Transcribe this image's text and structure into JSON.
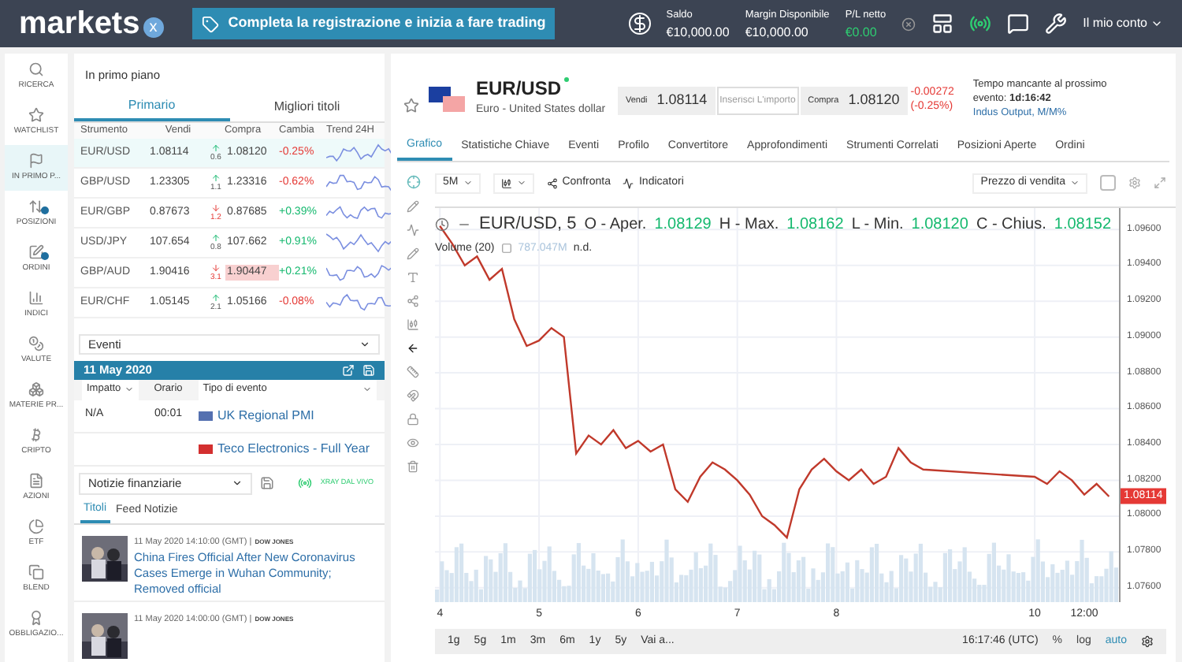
{
  "topbar": {
    "logo": "markets",
    "logo_mark": "x",
    "banner": "Completa la registrazione e inizia a fare trading",
    "stats": [
      {
        "label": "Saldo",
        "value": "€10,000.00",
        "positive": false
      },
      {
        "label": "Margin Disponibile",
        "value": "€10,000.00",
        "positive": false
      },
      {
        "label": "P/L netto",
        "value": "€0.00",
        "positive": true
      }
    ],
    "account": "Il mio conto"
  },
  "sidebar": {
    "items": [
      {
        "label": "RICERCA",
        "selected": false,
        "badge": false
      },
      {
        "label": "WATCHLIST",
        "selected": false,
        "badge": false
      },
      {
        "label": "IN PRIMO P...",
        "selected": true,
        "badge": false
      },
      {
        "label": "POSIZIONI",
        "selected": false,
        "badge": true
      },
      {
        "label": "ORDINI",
        "selected": false,
        "badge": true
      },
      {
        "label": "INDICI",
        "selected": false,
        "badge": false
      },
      {
        "label": "VALUTE",
        "selected": false,
        "badge": false
      },
      {
        "label": "MATERIE PR...",
        "selected": false,
        "badge": false
      },
      {
        "label": "CRIPTO",
        "selected": false,
        "badge": false
      },
      {
        "label": "AZIONI",
        "selected": false,
        "badge": false
      },
      {
        "label": "ETF",
        "selected": false,
        "badge": false
      },
      {
        "label": "BLEND",
        "selected": false,
        "badge": false
      },
      {
        "label": "OBBLIGAZIO...",
        "selected": false,
        "badge": false
      }
    ]
  },
  "featured": {
    "title": "In primo piano",
    "tabs": [
      {
        "label": "Primario",
        "selected": true
      },
      {
        "label": "Migliori titoli",
        "selected": false
      }
    ],
    "table": {
      "columns": [
        "Strumento",
        "Vendi",
        "Compra",
        "Cambia",
        "Trend 24H"
      ],
      "rows": [
        {
          "instrument": "EUR/USD",
          "sell": "1.08114",
          "up": true,
          "spread": "0.6",
          "buy": "1.08120",
          "change": "-0.25%",
          "selected": true,
          "flash": false
        },
        {
          "instrument": "GBP/USD",
          "sell": "1.23305",
          "up": true,
          "spread": "1.1",
          "buy": "1.23316",
          "change": "-0.62%",
          "selected": false,
          "flash": false
        },
        {
          "instrument": "EUR/GBP",
          "sell": "0.87673",
          "up": false,
          "spread": "1.2",
          "buy": "0.87685",
          "change": "+0.39%",
          "selected": false,
          "flash": false
        },
        {
          "instrument": "USD/JPY",
          "sell": "107.654",
          "up": true,
          "spread": "0.8",
          "buy": "107.662",
          "change": "+0.91%",
          "selected": false,
          "flash": false
        },
        {
          "instrument": "GBP/AUD",
          "sell": "1.90416",
          "up": false,
          "spread": "3.1",
          "buy": "1.90447",
          "change": "+0.21%",
          "selected": false,
          "flash": true
        },
        {
          "instrument": "EUR/CHF",
          "sell": "1.05145",
          "up": true,
          "spread": "2.1",
          "buy": "1.05166",
          "change": "-0.08%",
          "selected": false,
          "flash": false
        }
      ]
    }
  },
  "events": {
    "dropdown": "Eventi",
    "date": "11 May 2020",
    "filters": {
      "impact": "Impatto",
      "time": "Orario",
      "type": "Tipo di evento"
    },
    "rows": [
      {
        "impact": "N/A",
        "time": "00:01",
        "color": "#5470b0",
        "name": "UK Regional PMI"
      },
      {
        "color": "#d32f2f",
        "name": "Teco Electronics - Full Year"
      }
    ]
  },
  "news": {
    "dropdown": "Notizie finanziarie",
    "live": "XRAY DAL VIVO",
    "tabs": [
      {
        "label": "Titoli",
        "selected": true
      },
      {
        "label": "Feed Notizie",
        "selected": false
      }
    ],
    "items": [
      {
        "time": "11 May 2020 14:10:00 (GMT) |",
        "source": "DOW JONES",
        "headline": "China Fires Official After New Coronavirus Cases Emerge in Wuhan Community; Removed official"
      },
      {
        "time": "11 May 2020 14:00:00 (GMT) |",
        "source": "DOW JONES"
      }
    ]
  },
  "instrument": {
    "symbol": "EUR/USD",
    "name": "Euro - United States dollar",
    "sell_label": "Vendi",
    "sell": "1.08114",
    "amount_placeholder": "Inserisci L'importo",
    "buy_label": "Compra",
    "buy": "1.08120",
    "change": "-0.00272",
    "change_pct": "(-0.25%)",
    "next_event_label": "Tempo mancante al prossimo evento:",
    "next_event_time": "1d:16:42",
    "next_event_name": "Indus Output, M/M%"
  },
  "tabs": [
    {
      "label": "Grafico",
      "selected": true
    },
    {
      "label": "Statistiche Chiave",
      "selected": false
    },
    {
      "label": "Eventi",
      "selected": false
    },
    {
      "label": "Profilo",
      "selected": false
    },
    {
      "label": "Convertitore",
      "selected": false
    },
    {
      "label": "Approfondimenti",
      "selected": false
    },
    {
      "label": "Strumenti Correlati",
      "selected": false
    },
    {
      "label": "Posizioni Aperte",
      "selected": false
    },
    {
      "label": "Ordini",
      "selected": false
    }
  ],
  "toolbar": {
    "interval": "5M",
    "compare": "Confronta",
    "indicators": "Indicatori",
    "price_type": "Prezzo di vendita",
    "checkbox_checked": false
  },
  "legend": {
    "symbol": "EUR/USD, 5",
    "open_label": "O - Aper.",
    "open": "1.08129",
    "high_label": "H - Max.",
    "high": "1.08162",
    "low_label": "L - Min.",
    "low": "1.08120",
    "close_label": "C - Chius.",
    "close": "1.08152",
    "volume_label": "Volume (20)",
    "volume_value": "787.047M",
    "volume_extra": "n.d."
  },
  "price_marker": "1.08114",
  "x_time_label": "12:00",
  "chart_data": {
    "type": "line",
    "grid": true,
    "x": [
      4,
      4.125,
      4.25,
      4.375,
      4.5,
      4.625,
      4.75,
      4.875,
      5,
      5.125,
      5.25,
      5.375,
      5.5,
      5.625,
      5.75,
      5.875,
      6,
      6.125,
      6.25,
      6.375,
      6.5,
      6.625,
      6.75,
      6.875,
      7,
      7.125,
      7.25,
      7.375,
      7.5,
      7.625,
      7.75,
      7.875,
      8,
      8.125,
      8.25,
      8.375,
      8.5,
      8.625,
      8.75,
      8.875,
      10,
      10.125,
      10.25,
      10.375,
      10.5,
      10.625,
      10.75
    ],
    "series": [
      {
        "color": "#c0392b",
        "values": [
          1.0962,
          1.0952,
          1.094,
          1.0945,
          1.0932,
          1.0938,
          1.091,
          1.0895,
          1.0898,
          1.0905,
          1.09,
          1.0835,
          1.0845,
          1.084,
          1.0848,
          1.0838,
          1.0842,
          1.0836,
          1.084,
          1.0815,
          1.0808,
          1.0822,
          1.083,
          1.0826,
          1.082,
          1.0812,
          1.08,
          1.0795,
          1.0788,
          1.0815,
          1.0826,
          1.0832,
          1.0825,
          1.082,
          1.0826,
          1.0818,
          1.0822,
          1.0838,
          1.083,
          1.0826,
          1.0822,
          1.0818,
          1.0825,
          1.082,
          1.0812,
          1.0818,
          1.0811
        ]
      }
    ],
    "xlim": [
      3.95,
      10.85
    ],
    "ylim": [
      1.0752,
      1.0972
    ],
    "xticks": [
      4,
      5,
      6,
      7,
      8,
      10
    ],
    "yticks": [
      {
        "value": 1.096,
        "label": "1.09600"
      },
      {
        "value": 1.094,
        "label": "1.09400"
      },
      {
        "value": 1.092,
        "label": "1.09200"
      },
      {
        "value": 1.09,
        "label": "1.09000"
      },
      {
        "value": 1.088,
        "label": "1.08800"
      },
      {
        "value": 1.086,
        "label": "1.08600"
      },
      {
        "value": 1.084,
        "label": "1.08400"
      },
      {
        "value": 1.082,
        "label": "1.08200"
      },
      {
        "value": 1.08,
        "label": "1.08000"
      },
      {
        "value": 1.078,
        "label": "1.07800"
      },
      {
        "value": 1.076,
        "label": "1.07600"
      }
    ]
  },
  "ranges": [
    {
      "label": "1g"
    },
    {
      "label": "5g"
    },
    {
      "label": "1m"
    },
    {
      "label": "3m"
    },
    {
      "label": "6m"
    },
    {
      "label": "1y"
    },
    {
      "label": "5y"
    },
    {
      "label": "Vai a..."
    }
  ],
  "bottom": {
    "time": "16:17:46 (UTC)",
    "options": [
      {
        "label": "%",
        "selected": false
      },
      {
        "label": "log",
        "selected": false
      },
      {
        "label": "auto",
        "selected": true
      }
    ]
  }
}
